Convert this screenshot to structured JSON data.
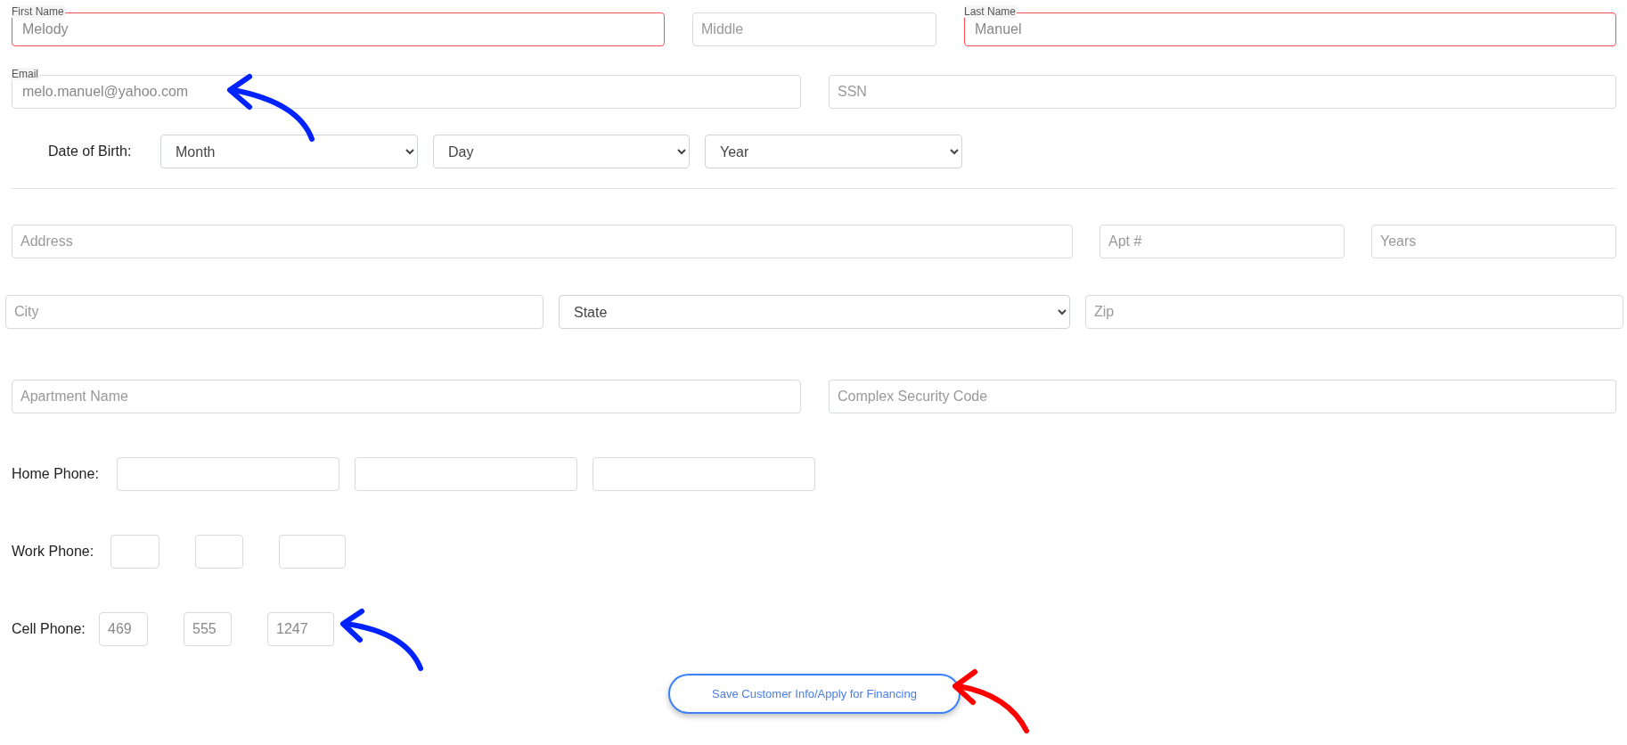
{
  "person": [
    {
      "label": "First Name",
      "value": "Melody",
      "invalid": true
    },
    {
      "placeholder": "Middle",
      "invalid": false
    },
    {
      "label": "Last Name",
      "value": "Manuel",
      "invalid": true
    }
  ],
  "contact": [
    {
      "label": "Email",
      "value": "melo.manuel@yahoo.com"
    },
    {
      "placeholder": "SSN"
    }
  ],
  "birth": {
    "label": "Date of Birth:",
    "selects": [
      "Month",
      "Day",
      "Year"
    ]
  },
  "address": [
    {
      "placeholder": "Address"
    },
    {
      "placeholder": "Apt #"
    },
    {
      "placeholder": "Years"
    }
  ],
  "locality": [
    {
      "kind": "input",
      "placeholder": "City"
    },
    {
      "kind": "select",
      "value": "State"
    },
    {
      "kind": "input",
      "placeholder": "Zip"
    }
  ],
  "apartment": [
    {
      "placeholder": "Apartment Name"
    },
    {
      "placeholder": "Complex Security Code"
    }
  ],
  "phones": [
    {
      "label": "Home Phone:",
      "parts": [
        {
          "kind": "empty"
        },
        {
          "kind": "empty"
        },
        {
          "kind": "empty"
        }
      ]
    },
    {
      "label": "Work Phone:",
      "parts": [
        {
          "kind": "empty"
        },
        {
          "kind": "empty"
        },
        {
          "kind": "empty"
        }
      ]
    },
    {
      "label": "Cell Phone:",
      "parts": [
        {
          "kind": "filled",
          "value": "469"
        },
        {
          "kind": "filled",
          "value": "555"
        },
        {
          "kind": "filled",
          "value": "1247"
        }
      ]
    }
  ],
  "submit": {
    "label": "Save Customer Info/Apply for Financing"
  },
  "annotations": [
    {
      "color": "#0022ff"
    },
    {
      "color": "#0022ff"
    },
    {
      "color": "#ff0000"
    }
  ]
}
